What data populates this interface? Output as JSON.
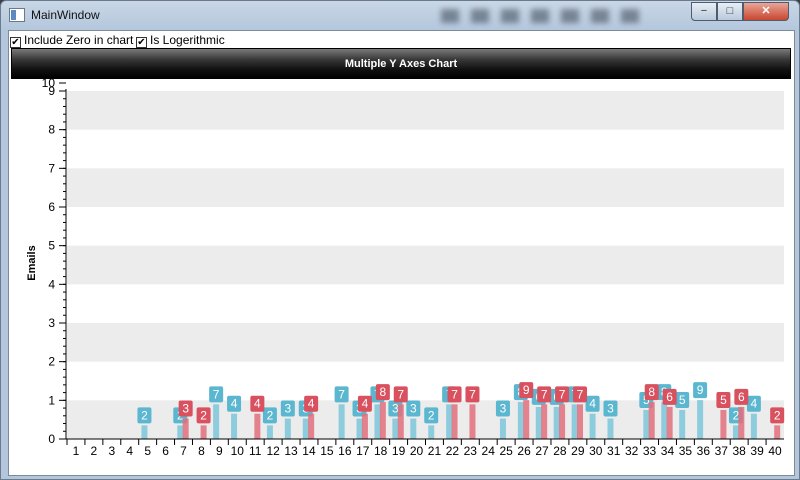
{
  "window": {
    "title": "MainWindow",
    "minimize": "−",
    "maximize": "□",
    "close": "✕"
  },
  "toolbar": {
    "include_zero": {
      "label": "Include Zero in chart",
      "checked": true
    },
    "logarithmic": {
      "label": "Is Logerithmic",
      "checked": true
    }
  },
  "colors": {
    "series_blue": "#7bc7da",
    "series_red": "#e26f7c",
    "band": "#ececec",
    "label_blue": "#5bb6cf",
    "label_red": "#d9505f"
  },
  "chart_data": {
    "type": "bar",
    "title": "Multiple Y Axes Chart",
    "ylabel": "Emails",
    "ylim": [
      0,
      9
    ],
    "yticks": [
      0,
      1,
      2,
      3,
      4,
      5,
      6,
      7,
      8,
      9
    ],
    "extra_tick_label": "10",
    "grid": true,
    "categories": [
      "1",
      "2",
      "3",
      "4",
      "5",
      "6",
      "7",
      "8",
      "9",
      "10",
      "11",
      "12",
      "13",
      "14",
      "15",
      "16",
      "17",
      "18",
      "19",
      "20",
      "21",
      "22",
      "23",
      "24",
      "25",
      "26",
      "27",
      "28",
      "29",
      "30",
      "31",
      "32",
      "33",
      "34",
      "35",
      "36",
      "37",
      "38",
      "39",
      "40"
    ],
    "series": [
      {
        "values": [
          null,
          null,
          null,
          null,
          2,
          null,
          2,
          null,
          7,
          4,
          null,
          2,
          3,
          3,
          null,
          7,
          3,
          7,
          3,
          3,
          2,
          7,
          null,
          null,
          3,
          8,
          6,
          6,
          7,
          4,
          3,
          null,
          5,
          8,
          5,
          9,
          null,
          2,
          4,
          null
        ]
      },
      {
        "values": [
          null,
          null,
          null,
          null,
          null,
          null,
          3,
          2,
          null,
          null,
          4,
          null,
          null,
          4,
          null,
          null,
          4,
          8,
          7,
          null,
          null,
          7,
          7,
          null,
          null,
          9,
          7,
          7,
          7,
          null,
          null,
          null,
          8,
          6,
          null,
          null,
          5,
          6,
          null,
          2
        ]
      }
    ]
  }
}
